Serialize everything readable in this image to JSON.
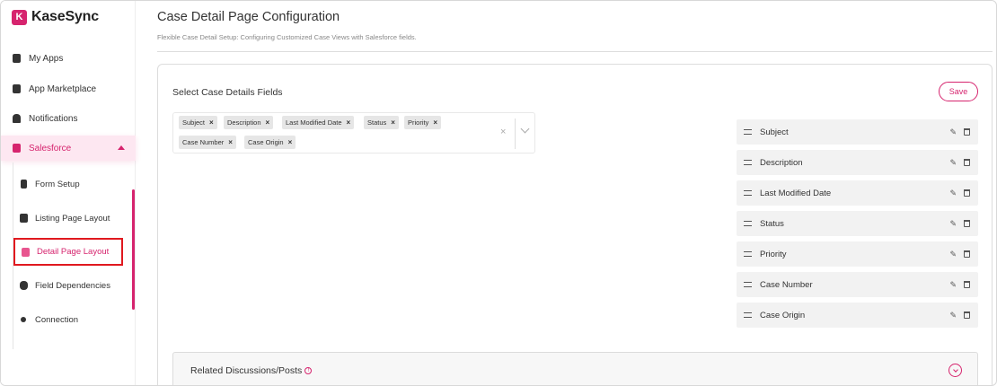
{
  "app": {
    "name": "KaseSync",
    "logo_glyph": "K"
  },
  "sidebar": {
    "items": [
      {
        "label": "My Apps",
        "icon": "chart-icon"
      },
      {
        "label": "App Marketplace",
        "icon": "marketplace-icon"
      },
      {
        "label": "Notifications",
        "icon": "bell-icon"
      },
      {
        "label": "Salesforce",
        "icon": "salesforce-icon",
        "active": true
      }
    ],
    "sub_items": [
      {
        "label": "Form Setup",
        "icon": "form-icon"
      },
      {
        "label": "Listing Page Layout",
        "icon": "list-layout-icon"
      },
      {
        "label": "Detail Page Layout",
        "icon": "detail-layout-icon",
        "active": true
      },
      {
        "label": "Field Dependencies",
        "icon": "dependency-icon"
      },
      {
        "label": "Connection",
        "icon": "connection-icon"
      }
    ]
  },
  "header": {
    "title": "Case Detail Page Configuration",
    "subtitle": "Flexible Case Detail Setup: Configuring Customized Case Views with Salesforce fields."
  },
  "card": {
    "title": "Select Case Details Fields",
    "save_label": "Save",
    "chips": [
      "Subject",
      "Description",
      "Last Modified Date",
      "Status",
      "Priority",
      "Case Number",
      "Case Origin"
    ],
    "clear_glyph": "×",
    "remove_glyph": "×",
    "fields": [
      "Subject",
      "Description",
      "Last Modified Date",
      "Status",
      "Priority",
      "Case Number",
      "Case Origin"
    ],
    "edit_glyph": "✎"
  },
  "related": {
    "title": "Related Discussions/Posts",
    "info_glyph": "!"
  },
  "colors": {
    "accent": "#d6246e",
    "active_bg": "#fde7f1",
    "highlight_border": "#e0191f"
  }
}
